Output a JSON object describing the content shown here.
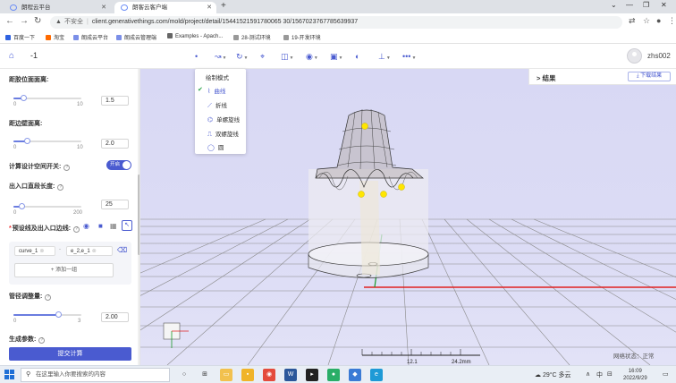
{
  "browser": {
    "tabs": [
      {
        "label": "朗程云平台",
        "active": false
      },
      {
        "label": "朗客云客户端",
        "active": true
      }
    ],
    "url_warning": "不安全",
    "url": "client.generativethings.com/mold/project/detail/15441521591780065 30/1567023767785639937",
    "bookmarks": [
      "百度一下",
      "淘宝",
      "朗成云平台",
      "朗成云管理端",
      "Examples - Apach...",
      "28-测试环境",
      "19-开发环境"
    ]
  },
  "app": {
    "project_name": "-1",
    "username": "zhs002",
    "dropdown": {
      "title": "绘制模式",
      "items": [
        {
          "label": "曲线",
          "icon": "curve-icon",
          "selected": true
        },
        {
          "label": "折线",
          "icon": "polyline-icon",
          "selected": false
        },
        {
          "label": "单螺旋线",
          "icon": "single-helix-icon",
          "selected": false
        },
        {
          "label": "双螺旋线",
          "icon": "double-helix-icon",
          "selected": false
        },
        {
          "label": "圆",
          "icon": "circle-icon",
          "selected": false
        }
      ]
    },
    "results": {
      "title": "结果",
      "download_label": "下载结果"
    },
    "network_status": "网络状态：正常"
  },
  "panel": {
    "field1": {
      "label": "距胶位面面离:",
      "min": "0",
      "max": "10",
      "value": "1.5",
      "fraction": 0.15
    },
    "field2": {
      "label": "距边壁面离:",
      "min": "0",
      "max": "10",
      "value": "2.0",
      "fraction": 0.2
    },
    "toggle": {
      "label": "计算设计空间开关:",
      "state": "开启"
    },
    "field3": {
      "label": "出入口直段长度:",
      "min": "0",
      "max": "200",
      "value": "25",
      "fraction": 0.125
    },
    "preset": {
      "label": "预设线及出入口边线:",
      "items": [
        {
          "left": "curve_1",
          "right": "e_2,e_1"
        }
      ],
      "add_label": "+ 添加一组"
    },
    "field4": {
      "label": "管径调整量:",
      "min": "0",
      "max": "3",
      "value": "2.00",
      "fraction": 0.6667
    },
    "gen_label": "生成参数:",
    "submit_label": "提交计算"
  },
  "scale": {
    "mid": "12.1",
    "end": "24.2mm"
  },
  "taskbar": {
    "search_placeholder": "在这里输入你要搜索的内容",
    "weather": "29°C 多云",
    "ime": "中",
    "time": "16:09",
    "date": "2022/9/29"
  }
}
